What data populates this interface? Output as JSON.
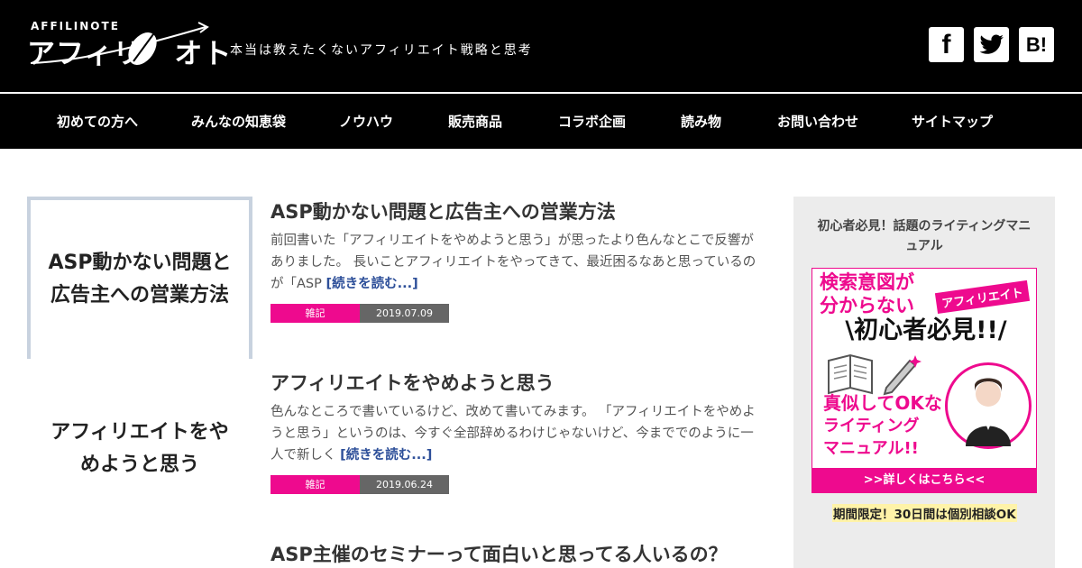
{
  "header": {
    "logo_small": "AFFILINOTE",
    "logo_main": "アフィリ",
    "logo_suffix": "オト",
    "tagline": "本当は教えたくないアフィリエイト戦略と思考",
    "sns": [
      {
        "name": "facebook",
        "glyph": "f"
      },
      {
        "name": "twitter",
        "glyph": "twitter-bird"
      },
      {
        "name": "hatena",
        "glyph": "B!"
      }
    ]
  },
  "nav": {
    "items": [
      {
        "label": "初めての方へ"
      },
      {
        "label": "みんなの知恵袋"
      },
      {
        "label": "ノウハウ"
      },
      {
        "label": "販売商品"
      },
      {
        "label": "コラボ企画"
      },
      {
        "label": "読み物"
      },
      {
        "label": "お問い合わせ"
      },
      {
        "label": "サイトマップ"
      }
    ]
  },
  "articles": [
    {
      "thumb_text_1": "ASP動かない問題と",
      "thumb_text_2": "広告主への営業方法",
      "title": "ASP動かない問題と広告主への営業方法",
      "excerpt": "前回書いた「アフィリエイトをやめようと思う」が思ったより色んなとこで反響がありました。 長いことアフィリエイトをやってきて、最近困るなあと思っているのが「ASP ",
      "more": "[続きを読む...]",
      "category": "雑記",
      "date": "2019.07.09"
    },
    {
      "thumb_text_1": "アフィリエイトをや",
      "thumb_text_2": "めようと思う",
      "title": "アフィリエイトをやめようと思う",
      "excerpt": "色んなところで書いているけど、改めて書いてみます。 「アフィリエイトをやめようと思う」というのは、今すぐ全部辞めるわけじゃないけど、今まででのように一人で新しく ",
      "more": "[続きを読む...]",
      "category": "雑記",
      "date": "2019.06.24"
    },
    {
      "title": "ASP主催のセミナーって面白いと思ってる人いるの？"
    }
  ],
  "sidebar": {
    "title": "初心者必見！話題のライティングマニュアル",
    "banner": {
      "line1": "検索意図が",
      "line2": "分からない",
      "tag": "アフィリエイト",
      "headline": "\\初心者必見!!/",
      "copy1": "真似してOKな",
      "copy2": "ライティング",
      "copy3": "マニュアル!!",
      "footer": ">>詳しくはこちら<<"
    },
    "note": "期間限定！30日間は個別相談OK"
  },
  "colors": {
    "header_bg": "#000000",
    "accent_pink": "#ee0a8e",
    "date_gray": "#666666",
    "link_blue": "#2d4f99",
    "sidebar_bg": "#ececec"
  }
}
